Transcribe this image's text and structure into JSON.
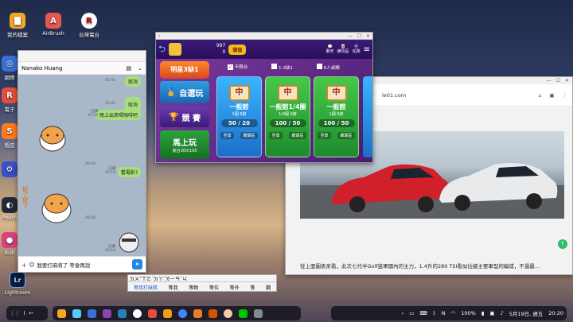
{
  "desktop": {
    "icons": [
      {
        "label": "我的檔案",
        "color": "#f6a623",
        "glyph": "▇"
      },
      {
        "label": "AirBrush",
        "color": "#e8584b",
        "glyph": "A"
      },
      {
        "label": "台灣電台",
        "color": "#ffffff",
        "glyph": "R"
      },
      {
        "label": "網際",
        "color": "#3b6fd8",
        "glyph": "◎"
      },
      {
        "label": "電子",
        "color": "#e74c3c",
        "glyph": "R"
      },
      {
        "label": "蝦皮",
        "color": "#ff7a1a",
        "glyph": "S"
      },
      {
        "label": "",
        "color": "#3b4fc8",
        "glyph": "⚙"
      },
      {
        "label": "Photo",
        "color": "#1f2a3a",
        "glyph": "◐"
      },
      {
        "label": "Bub",
        "color": "#d8437c",
        "glyph": "●"
      },
      {
        "label": "Lightroom",
        "color": "#0b1d3a",
        "glyph": "Lr"
      }
    ]
  },
  "line": {
    "contact": "Nanako Huang",
    "messages": [
      {
        "text": "取消",
        "time": "15:41",
        "side": "right"
      },
      {
        "text": "取消",
        "time": "15:43",
        "side": "right"
      },
      {
        "text": "晚上出來喝咖啡吧",
        "read": "已讀",
        "time": "20:18",
        "side": "right"
      },
      {
        "text": "看電影?",
        "read": "已讀",
        "time": "20:19",
        "side": "right"
      }
    ],
    "sticker_times": [
      "20:18",
      "20:18"
    ],
    "sticker_text": "好了好了",
    "last_read": "已讀",
    "last_time": "20:19",
    "input_value": "我要打麻將了 等會再說",
    "send_icon": "send-icon"
  },
  "game": {
    "coins": "997",
    "diamonds": "0",
    "store": "儲值",
    "top_icons": [
      "聊天",
      "練功區",
      "任務"
    ],
    "logo": "明星3缺1",
    "modes": [
      "自選玩",
      "競 賽",
      "馬上玩"
    ],
    "mode_sub": "底台300/100",
    "checks": [
      {
        "label": "不限台",
        "checked": true
      },
      {
        "label": "1-3缺1",
        "checked": false
      },
      {
        "label": "6人桌開",
        "checked": false
      }
    ],
    "tables": [
      {
        "name": "一般館",
        "sub": "1圈 6將",
        "count": "50 / 20",
        "b1": "至尊",
        "b2": "藏寶區",
        "color": "#1c8fd6"
      },
      {
        "name": "一般館1/4圈",
        "sub": "1/4圈 6將",
        "count": "100 / 50",
        "b1": "至尊",
        "b2": "藏寶區",
        "color": "#2aa43a"
      },
      {
        "name": "一般館",
        "sub": "1圈 6將",
        "count": "100 / 50",
        "b1": "至尊",
        "b2": "藏寶區",
        "color": "#2aa43a"
      }
    ]
  },
  "browser": {
    "url": "le01.com",
    "article": "從上面圖表來看，此次七代半Golf進軍國內的主力，1.4升的280 TSI看似佔據主要車型的編成，不過最..."
  },
  "ime": {
    "composition": "ㄉㄨˇㄒㄛˊㄉㄚˇㄌㄧㄢˋㄐ",
    "candidates": [
      "等我打麻將",
      "等我",
      "等物",
      "等位",
      "等外",
      "等",
      "戳"
    ]
  },
  "taskbar": {
    "apps": [
      "app1",
      "app2",
      "app3",
      "app4",
      "app5",
      "app6",
      "app7",
      "app8",
      "app9",
      "app10",
      "app11",
      "app12",
      "app13",
      "app14"
    ],
    "battery": "100%",
    "date": "5月19日, 週五",
    "time": "20:20"
  },
  "colors": {
    "line_green": "#a6e07a",
    "game_bg": "#5a1a7a",
    "chat_bg": "#a8b8c9"
  }
}
